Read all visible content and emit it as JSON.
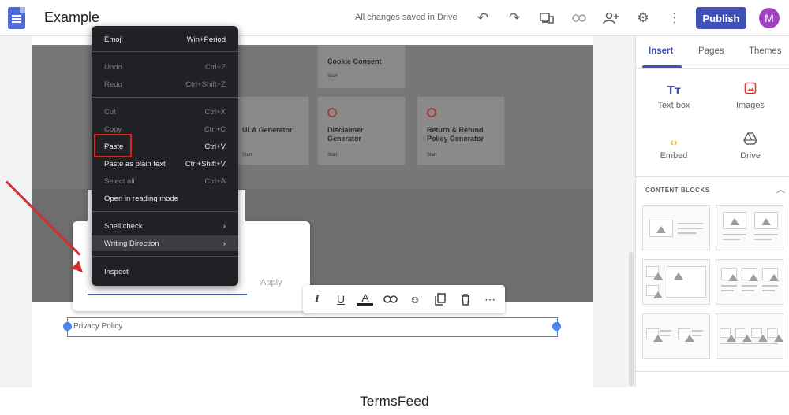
{
  "header": {
    "title": "Example",
    "save_status": "All changes saved in Drive",
    "publish_label": "Publish",
    "avatar_letter": "M",
    "icons": [
      "undo-icon",
      "redo-icon",
      "preview-icon",
      "link-icon",
      "share-icon",
      "gear-icon",
      "more-vert-icon"
    ]
  },
  "page": {
    "cards": [
      {
        "title": "Cookie Consent",
        "link": "Start"
      },
      {
        "title": "ULA Generator",
        "link": "Start"
      },
      {
        "title": "Disclaimer Generator",
        "link": "Start"
      },
      {
        "title": "Return & Refund Policy Generator",
        "link": "Start"
      }
    ],
    "text_box_content": "Privacy Policy"
  },
  "context_menu": {
    "items": [
      {
        "label": "Emoji",
        "shortcut": "Win+Period",
        "disabled": false
      },
      {
        "label": "Undo",
        "shortcut": "Ctrl+Z",
        "disabled": true
      },
      {
        "label": "Redo",
        "shortcut": "Ctrl+Shift+Z",
        "disabled": true
      },
      {
        "label": "Cut",
        "shortcut": "Ctrl+X",
        "disabled": true
      },
      {
        "label": "Copy",
        "shortcut": "Ctrl+C",
        "disabled": true
      },
      {
        "label": "Paste",
        "shortcut": "Ctrl+V",
        "disabled": false
      },
      {
        "label": "Paste as plain text",
        "shortcut": "Ctrl+Shift+V",
        "disabled": false
      },
      {
        "label": "Select all",
        "shortcut": "Ctrl+A",
        "disabled": true
      },
      {
        "label": "Open in reading mode",
        "shortcut": "",
        "disabled": false
      },
      {
        "label": "Spell check",
        "shortcut": "›",
        "disabled": false
      },
      {
        "label": "Writing Direction",
        "shortcut": "›",
        "disabled": false
      },
      {
        "label": "Inspect",
        "shortcut": "",
        "disabled": false
      }
    ]
  },
  "link_popup": {
    "apply_label": "Apply"
  },
  "right_panel": {
    "tabs": [
      "Insert",
      "Pages",
      "Themes"
    ],
    "active_tab": "Insert",
    "insert_items": [
      {
        "label": "Text box",
        "icon": "text-box-icon",
        "color": "#3f51b5"
      },
      {
        "label": "Images",
        "icon": "image-icon",
        "color": "#e53935"
      },
      {
        "label": "Embed",
        "icon": "embed-icon",
        "color": "#f4b400"
      },
      {
        "label": "Drive",
        "icon": "drive-icon",
        "color": "#5f6368"
      }
    ],
    "content_blocks_heading": "CONTENT BLOCKS"
  },
  "footer": {
    "brand": "TermsFeed"
  },
  "colors": {
    "accent": "#3f51b5",
    "highlight": "#e02020",
    "arrow": "#d32f2f",
    "avatar": "#a142c2"
  }
}
